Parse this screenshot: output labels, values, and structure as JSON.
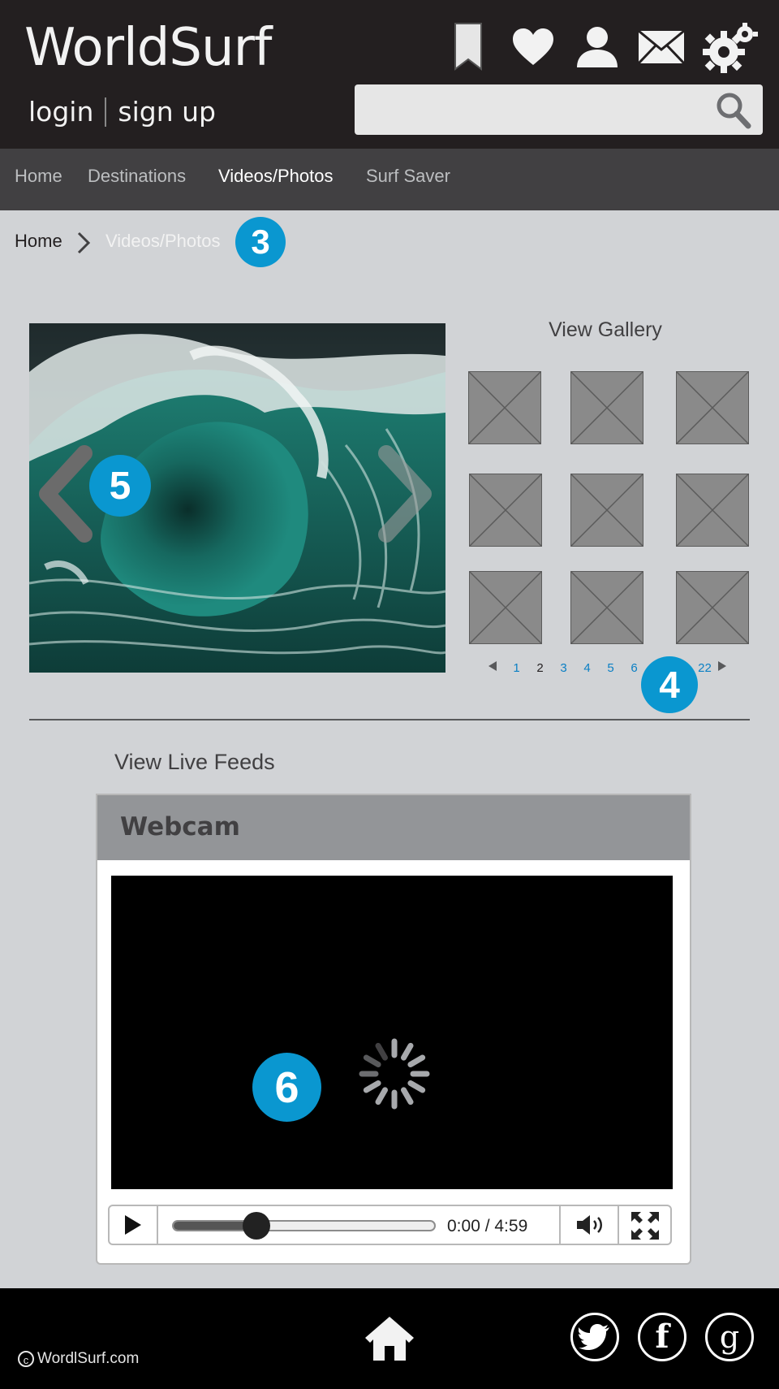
{
  "header": {
    "logo": "WorldSurf",
    "login_label": "login",
    "signup_label": "sign up",
    "search_placeholder": ""
  },
  "nav": {
    "items": [
      {
        "label": "Home"
      },
      {
        "label": "Destinations"
      },
      {
        "label": "Videos/Photos",
        "active": true
      },
      {
        "label": "Surf Saver"
      }
    ]
  },
  "breadcrumb": {
    "home": "Home",
    "current": "Videos/Photos"
  },
  "annotations": {
    "b3": "3",
    "b4": "4",
    "b5": "5",
    "b6": "6"
  },
  "gallery": {
    "title": "View Gallery",
    "pages": [
      "1",
      "2",
      "3",
      "4",
      "5",
      "6",
      "22"
    ],
    "current_page": "2"
  },
  "feeds": {
    "title": "View Live Feeds",
    "webcam_title": "Webcam",
    "time": "0:00 / 4:59",
    "progress": 0.32
  },
  "footer": {
    "copyright": "WordlSurf.com"
  },
  "colors": {
    "accent_badge": "#0a97d0",
    "header_bg": "#231f20",
    "nav_bg": "#414042",
    "page_bg": "#d1d3d6",
    "link": "#0a7fc4"
  }
}
